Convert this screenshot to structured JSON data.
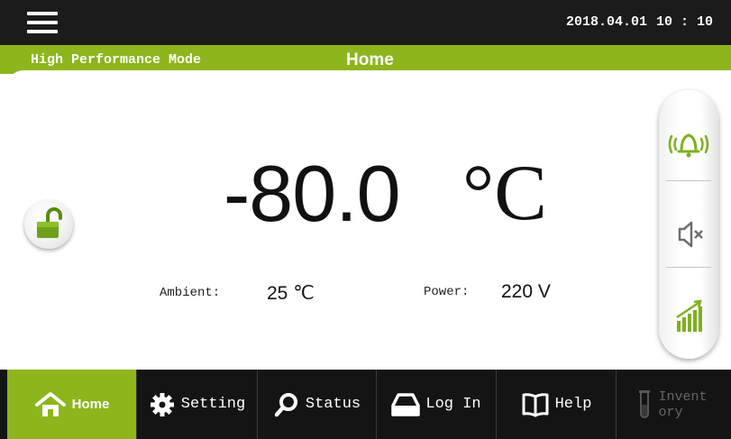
{
  "topbar": {
    "date": "2018.04.01",
    "time": "10 : 10"
  },
  "modebar": {
    "mode": "High Performance Mode",
    "title": "Home"
  },
  "main": {
    "temperature": "-80.0",
    "temperature_unit": "°C",
    "ambient_label": "Ambient:",
    "ambient_value": "25 ℃",
    "power_label": "Power:",
    "power_value": "220 V"
  },
  "side_panel": {
    "icons": [
      "alarm-bell-icon",
      "mute-speaker-icon",
      "signal-bars-icon"
    ]
  },
  "nav": [
    {
      "label": "Home",
      "icon": "home-icon"
    },
    {
      "label": "Setting",
      "icon": "gear-icon"
    },
    {
      "label": "Status",
      "icon": "search-icon"
    },
    {
      "label": "Log In",
      "icon": "tray-icon"
    },
    {
      "label": "Help",
      "icon": "book-icon"
    },
    {
      "label": "Invent ory",
      "icon": "test-tube-icon"
    }
  ],
  "colors": {
    "accent": "#8cb61c",
    "topbar": "#1b1b1b",
    "navbar": "#141414"
  }
}
